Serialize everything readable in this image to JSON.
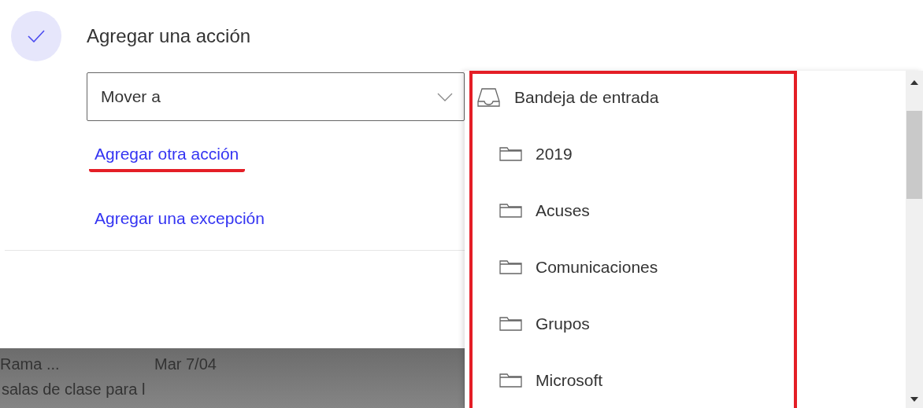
{
  "step": {
    "checked": true,
    "title": "Agregar una acción"
  },
  "action_select": {
    "value": "Mover a"
  },
  "links": [
    {
      "label": "Agregar otra acción",
      "highlighted": true
    },
    {
      "label": "Agregar una excepción",
      "highlighted": false
    }
  ],
  "mail_list": {
    "rows": [
      {
        "sender": "Rama ...",
        "date": "Mar 7/04",
        "preview": "salas de clase para l"
      }
    ]
  },
  "folder_menu": {
    "highlighted": true,
    "folders": [
      {
        "name": "Bandeja de entrada",
        "kind": "inbox",
        "children": [
          {
            "name": "2019",
            "kind": "folder"
          },
          {
            "name": "Acuses",
            "kind": "folder"
          },
          {
            "name": "Comunicaciones",
            "kind": "folder"
          },
          {
            "name": "Grupos",
            "kind": "folder"
          },
          {
            "name": "Microsoft",
            "kind": "folder"
          }
        ]
      }
    ]
  }
}
